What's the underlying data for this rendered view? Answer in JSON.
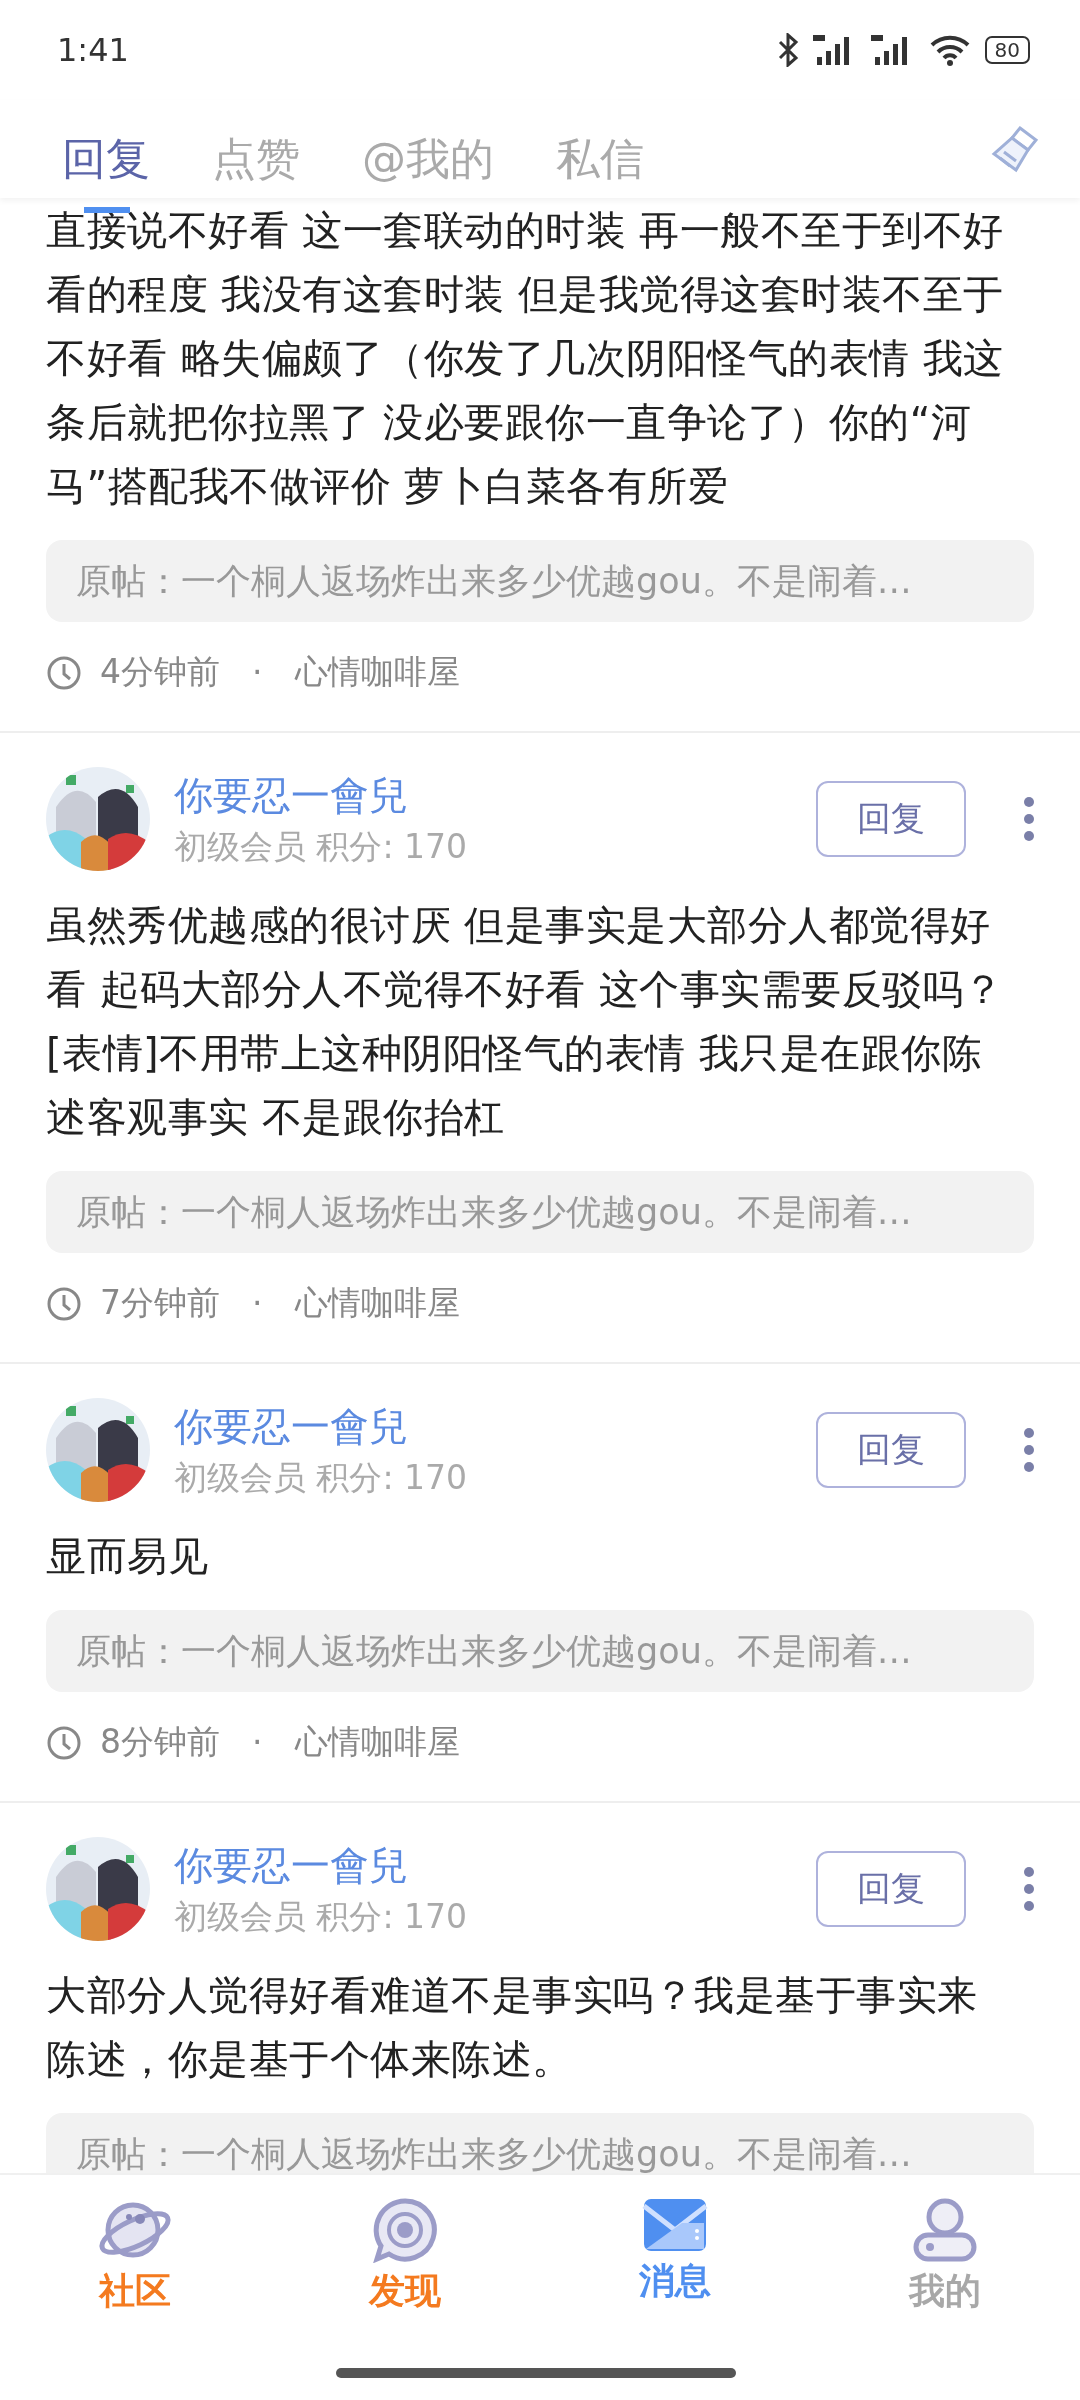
{
  "status_bar": {
    "time": "1:41",
    "battery": "80"
  },
  "tabs": [
    {
      "label": "回复",
      "selected": true
    },
    {
      "label": "点赞",
      "selected": false
    },
    {
      "label": "@我的",
      "selected": false
    },
    {
      "label": "私信",
      "selected": false
    }
  ],
  "posts": [
    {
      "body": "直接说不好看 这一套联动的时装 再一般不至于到不好看的程度 我没有这套时装 但是我觉得这套时装不至于不好看 略失偏颇了（你发了几次阴阳怪气的表情 我这条后就把你拉黑了 没必要跟你一直争论了）你的“河马”搭配我不做评价 萝卜白菜各有所爱",
      "original": "原帖：一个桐人返场炸出来多少优越gou。不是闹着…",
      "time": "4分钟前",
      "separator": "·",
      "forum": "心情咖啡屋"
    },
    {
      "author": {
        "name": "你要忍一會兒",
        "rank": "初级会员 积分: 170",
        "reply": "回复"
      },
      "body": "虽然秀优越感的很讨厌 但是事实是大部分人都觉得好看 起码大部分人不觉得不好看 这个事实需要反驳吗？ [表情]不用带上这种阴阳怪气的表情 我只是在跟你陈述客观事实 不是跟你抬杠",
      "original": "原帖：一个桐人返场炸出来多少优越gou。不是闹着…",
      "time": "7分钟前",
      "separator": "·",
      "forum": "心情咖啡屋"
    },
    {
      "author": {
        "name": "你要忍一會兒",
        "rank": "初级会员 积分: 170",
        "reply": "回复"
      },
      "body": "显而易见",
      "original": "原帖：一个桐人返场炸出来多少优越gou。不是闹着…",
      "time": "8分钟前",
      "separator": "·",
      "forum": "心情咖啡屋"
    },
    {
      "author": {
        "name": "你要忍一會兒",
        "rank": "初级会员 积分: 170",
        "reply": "回复"
      },
      "body": "大部分人觉得好看难道不是事实吗？我是基于事实来陈述，你是基于个体来陈述。",
      "original": "原帖：一个桐人返场炸出来多少优越gou。不是闹着…"
    }
  ],
  "nav": [
    {
      "kind": "community",
      "label": "社区",
      "color": "#f47a1f"
    },
    {
      "kind": "discover",
      "label": "发现",
      "color": "#f47a1f"
    },
    {
      "kind": "messages",
      "label": "消息",
      "color": "#4f8ff0"
    },
    {
      "kind": "profile",
      "label": "我的",
      "color": "#a8a8a8"
    }
  ]
}
